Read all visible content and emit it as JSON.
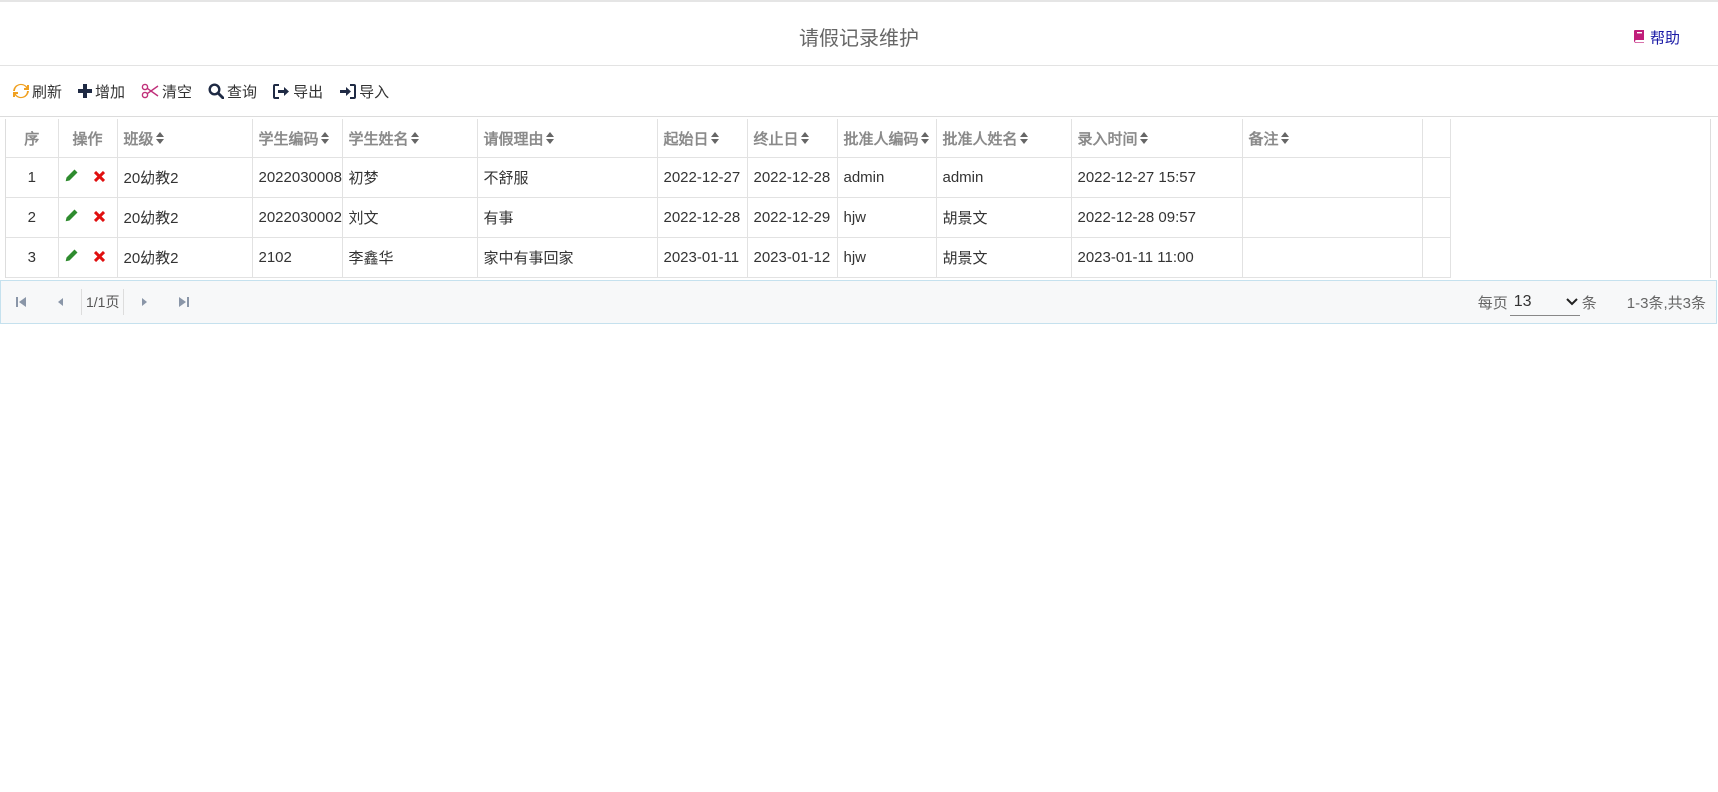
{
  "page": {
    "title": "请假记录维护",
    "help_label": "帮助"
  },
  "toolbar": {
    "refresh": "刷新",
    "add": "增加",
    "clear": "清空",
    "query": "查询",
    "export": "导出",
    "import": "导入"
  },
  "grid": {
    "columns": [
      "序",
      "操作",
      "班级",
      "学生编码",
      "学生姓名",
      "请假理由",
      "起始日",
      "终止日",
      "批准人编码",
      "批准人姓名",
      "录入时间",
      "备注"
    ],
    "rows": [
      [
        "1",
        "20幼教2",
        "2022030008",
        "初梦",
        "不舒服",
        "2022-12-27",
        "2022-12-28",
        "admin",
        "admin",
        "2022-12-27 15:57",
        ""
      ],
      [
        "2",
        "20幼教2",
        "2022030002",
        "刘文",
        "有事",
        "2022-12-28",
        "2022-12-29",
        "hjw",
        "胡景文",
        "2022-12-28 09:57",
        ""
      ],
      [
        "3",
        "20幼教2",
        "2102",
        "李鑫华",
        "家中有事回家",
        "2023-01-11",
        "2023-01-12",
        "hjw",
        "胡景文",
        "2023-01-11 11:00",
        ""
      ]
    ]
  },
  "pager": {
    "page_info": "1/1页",
    "per_page_label": "每页",
    "page_size": "13",
    "unit": "条",
    "summary": "1-3条,共3条"
  },
  "colors": {
    "edit": "#2e8b2e",
    "delete": "#e01010",
    "refresh": "#f0a020",
    "clear": "#c0307a",
    "help": "#c01d7a",
    "icon_dark": "#1f2a44"
  }
}
